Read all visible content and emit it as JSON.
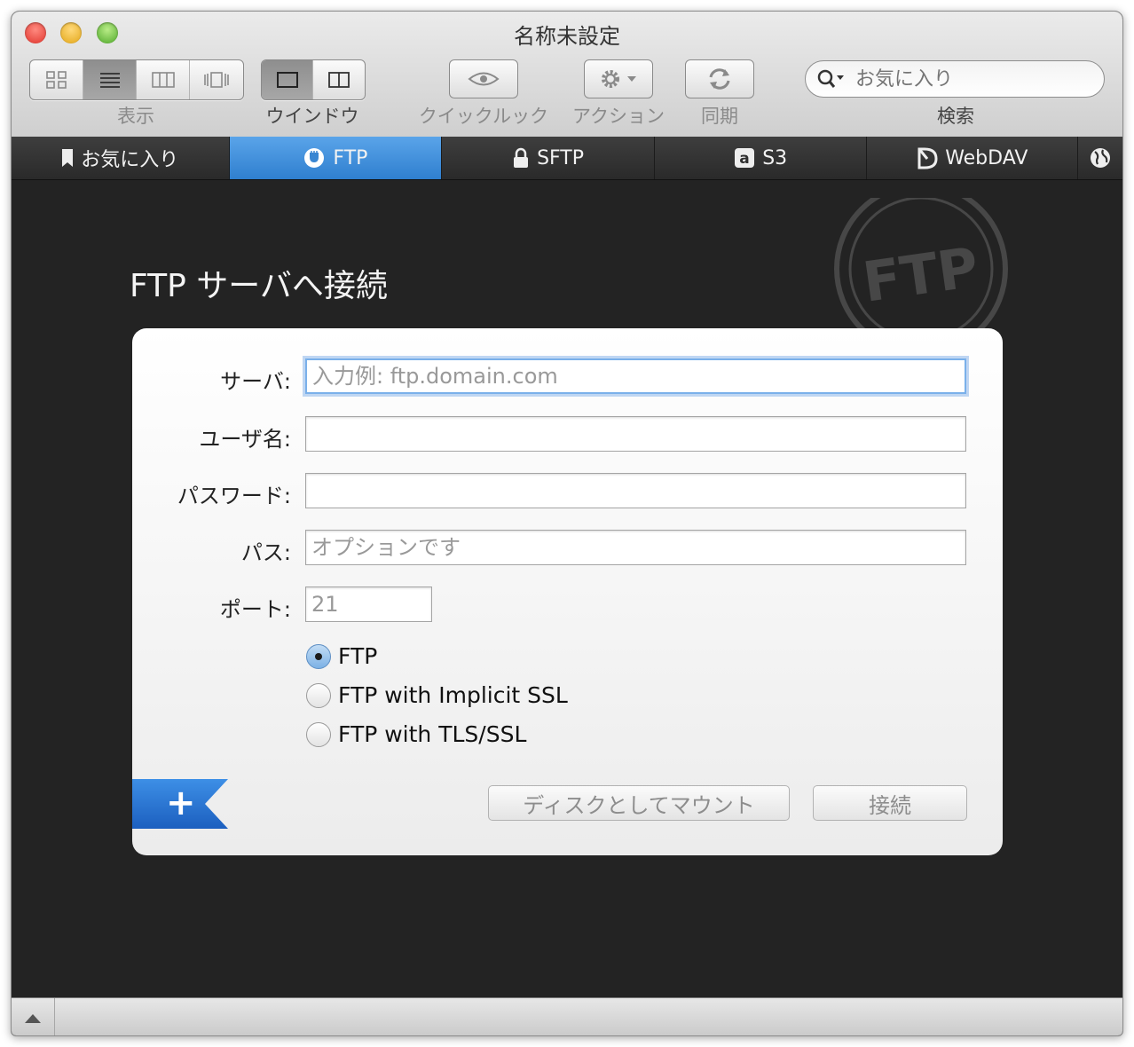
{
  "window": {
    "title": "名称未設定"
  },
  "toolbar": {
    "view_label": "表示",
    "window_label": "ウインドウ",
    "quicklook_label": "クイックルック",
    "action_label": "アクション",
    "sync_label": "同期",
    "search_label": "検索",
    "search_placeholder": "お気に入り"
  },
  "tabs": [
    {
      "label": "お気に入り",
      "icon": "bookmark-icon"
    },
    {
      "label": "FTP",
      "icon": "ftp-icon",
      "active": true
    },
    {
      "label": "SFTP",
      "icon": "lock-icon"
    },
    {
      "label": "S3",
      "icon": "amazon-icon"
    },
    {
      "label": "WebDAV",
      "icon": "webdav-icon"
    },
    {
      "label": "",
      "icon": "globe-icon"
    }
  ],
  "main": {
    "heading": "FTP サーバへ接続",
    "stamp_text": "FTP"
  },
  "form": {
    "server_label": "サーバ:",
    "server_placeholder": "入力例: ftp.domain.com",
    "username_label": "ユーザ名:",
    "password_label": "パスワード:",
    "path_label": "パス:",
    "path_placeholder": "オプションです",
    "port_label": "ポート:",
    "port_placeholder": "21",
    "protocols": [
      {
        "label": "FTP",
        "selected": true
      },
      {
        "label": "FTP with Implicit SSL",
        "selected": false
      },
      {
        "label": "FTP with TLS/SSL",
        "selected": false
      }
    ],
    "mount_button": "ディスクとしてマウント",
    "connect_button": "接続",
    "add_favorite_symbol": "+"
  },
  "colors": {
    "active_tab": "#3a8ad8",
    "panel_bg": "#f4f4f4",
    "window_bg": "#232323",
    "focus_ring": "#7ab0ea"
  }
}
